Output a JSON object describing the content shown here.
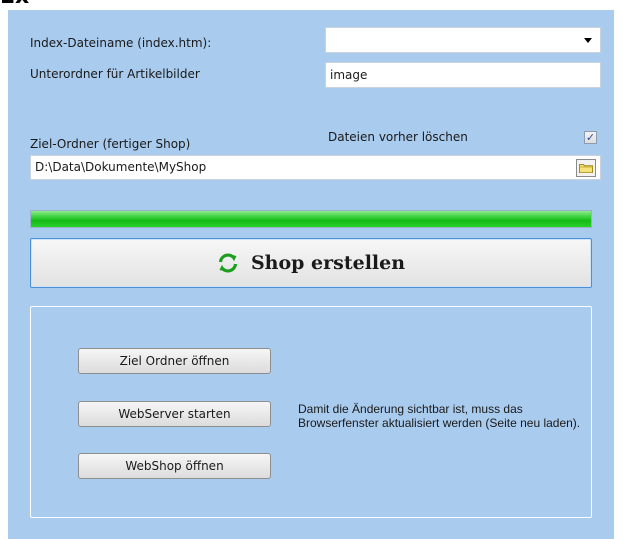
{
  "form": {
    "index_label": "Index-Dateiname (index.htm):",
    "index_value": "",
    "subfolder_label": "Unterordner für Artikelbilder",
    "subfolder_value": "image",
    "target_label": "Ziel-Ordner (fertiger Shop)",
    "delete_label": "Dateien vorher löschen",
    "delete_checked": true,
    "checkmark": "✓",
    "target_path": "D:\\Data\\Dokumente\\MyShop"
  },
  "progress": {
    "percent": 100,
    "color": "#2ad22a"
  },
  "create_button": {
    "label": "Shop erstellen",
    "icon": "refresh-icon",
    "icon_color": "#1e9e1e"
  },
  "actions": {
    "open_target": "Ziel Ordner öffnen",
    "start_server": "WebServer starten",
    "open_shop": "WebShop öffnen",
    "note": "Damit die Änderung sichtbar ist, muss das Browserfenster aktualisiert werden (Seite neu laden)."
  }
}
